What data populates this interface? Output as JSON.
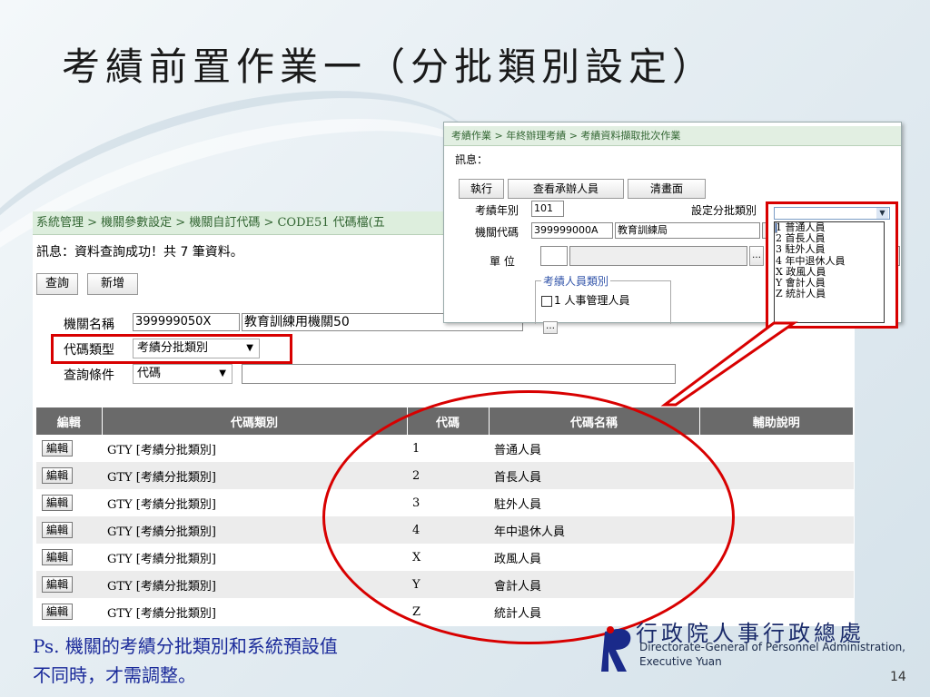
{
  "slide": {
    "title": "考績前置作業一（分批類別設定）",
    "note_line1": "Ps. 機關的考績分批類別和系統預設值",
    "note_line2": "不同時，才需調整。",
    "logo_zh": "行政院人事行政總處",
    "logo_en1": "Directorate-General of Personnel Administration,",
    "logo_en2": "Executive Yuan",
    "page_number": "14"
  },
  "main": {
    "breadcrumb": "系統管理 > 機關參數設定 > 機關自訂代碼 > CODE51 代碼檔(五",
    "message": "訊息：資料查詢成功！共 7 筆資料。",
    "query_button": "查詢",
    "add_button": "新增",
    "agency_label": "機關名稱",
    "agency_code": "399999050X",
    "agency_name": "教育訓練用機關50",
    "codetype_label": "代碼類型",
    "codetype_value": "考績分批類別",
    "condition_label": "查詢條件",
    "condition_value": "代碼",
    "condition_input": "",
    "columns": [
      "編輯",
      "代碼類別",
      "代碼",
      "代碼名稱",
      "輔助說明"
    ],
    "edit_label": "編輯",
    "rows": [
      {
        "category": "GTY [考績分批類別]",
        "code": "1",
        "name": "普通人員",
        "note": ""
      },
      {
        "category": "GTY [考績分批類別]",
        "code": "2",
        "name": "首長人員",
        "note": ""
      },
      {
        "category": "GTY [考績分批類別]",
        "code": "3",
        "name": "駐外人員",
        "note": ""
      },
      {
        "category": "GTY [考績分批類別]",
        "code": "4",
        "name": "年中退休人員",
        "note": ""
      },
      {
        "category": "GTY [考績分批類別]",
        "code": "X",
        "name": "政風人員",
        "note": ""
      },
      {
        "category": "GTY [考績分批類別]",
        "code": "Y",
        "name": "會計人員",
        "note": ""
      },
      {
        "category": "GTY [考績分批類別]",
        "code": "Z",
        "name": "統計人員",
        "note": ""
      }
    ]
  },
  "popup": {
    "breadcrumb": "考績作業 > 年終辦理考績 > 考績資料擷取批次作業",
    "message": "訊息：",
    "run_button": "執行",
    "view_button": "查看承辦人員",
    "clear_button": "清畫面",
    "year_label": "考績年別",
    "year_value": "101",
    "batch_label": "設定分批類別",
    "agency_label": "機關代碼",
    "agency_code": "399999000A",
    "agency_name": "教育訓練局",
    "unit_label": "單 位",
    "unit_value": "",
    "fieldset_legend": "考績人員類別",
    "checkbox1": "1 人事管理人員",
    "dropdown_options": [
      "",
      "1 普通人員",
      "2 首長人員",
      "3 駐外人員",
      "4 年中退休人員",
      "X 政風人員",
      "Y 會計人員",
      "Z 統計人員"
    ]
  }
}
